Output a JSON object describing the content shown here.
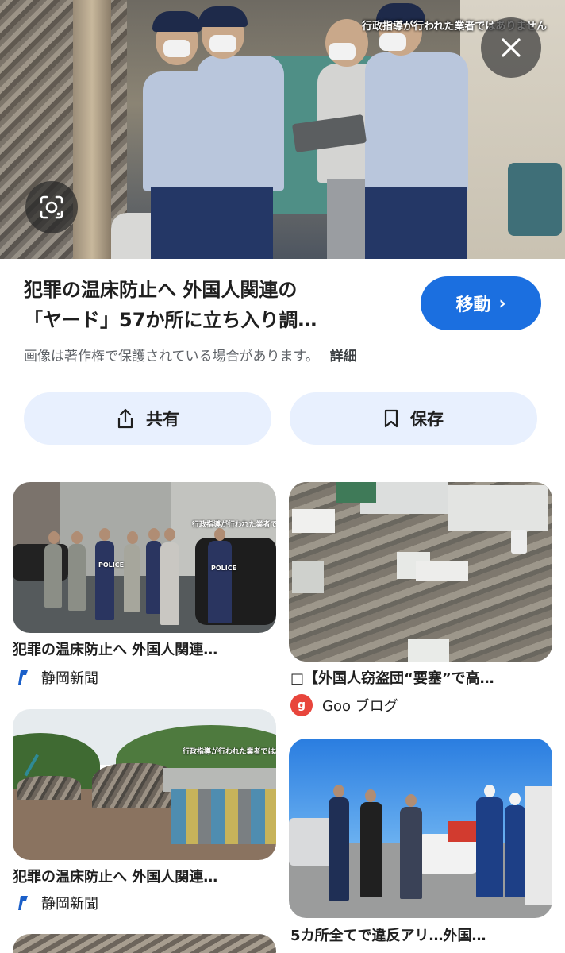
{
  "hero": {
    "caption": "行政指導が行われた業者ではありません",
    "close_icon": "close-icon",
    "lens_icon": "google-lens-icon"
  },
  "result": {
    "title_line1": "犯罪の温床防止へ 外国人関連の",
    "title_line2": "「ヤード」57か所に立ち入り調…",
    "visit_label": "移動",
    "visit_chevron": "›",
    "copyright": "画像は著作権で保護されている場合があります。",
    "more_label": "詳細",
    "accent": "#1b6fe0"
  },
  "actions": {
    "share_label": "共有",
    "save_label": "保存"
  },
  "related": [
    {
      "title": "犯罪の温床防止へ 外国人関連…",
      "source": "静岡新聞",
      "caption": "行政指導が行われた業者ではありません",
      "vest": "POLICE"
    },
    {
      "title": "□【外国人窃盗団“要塞”で高…",
      "source": "Goo ブログ",
      "source_badge": "g"
    },
    {
      "title": "犯罪の温床防止へ 外国人関連…",
      "source": "静岡新聞",
      "caption": "行政指導が行われた業者ではありません"
    },
    {
      "title": "5カ所全てで違反アリ…外国…"
    }
  ]
}
